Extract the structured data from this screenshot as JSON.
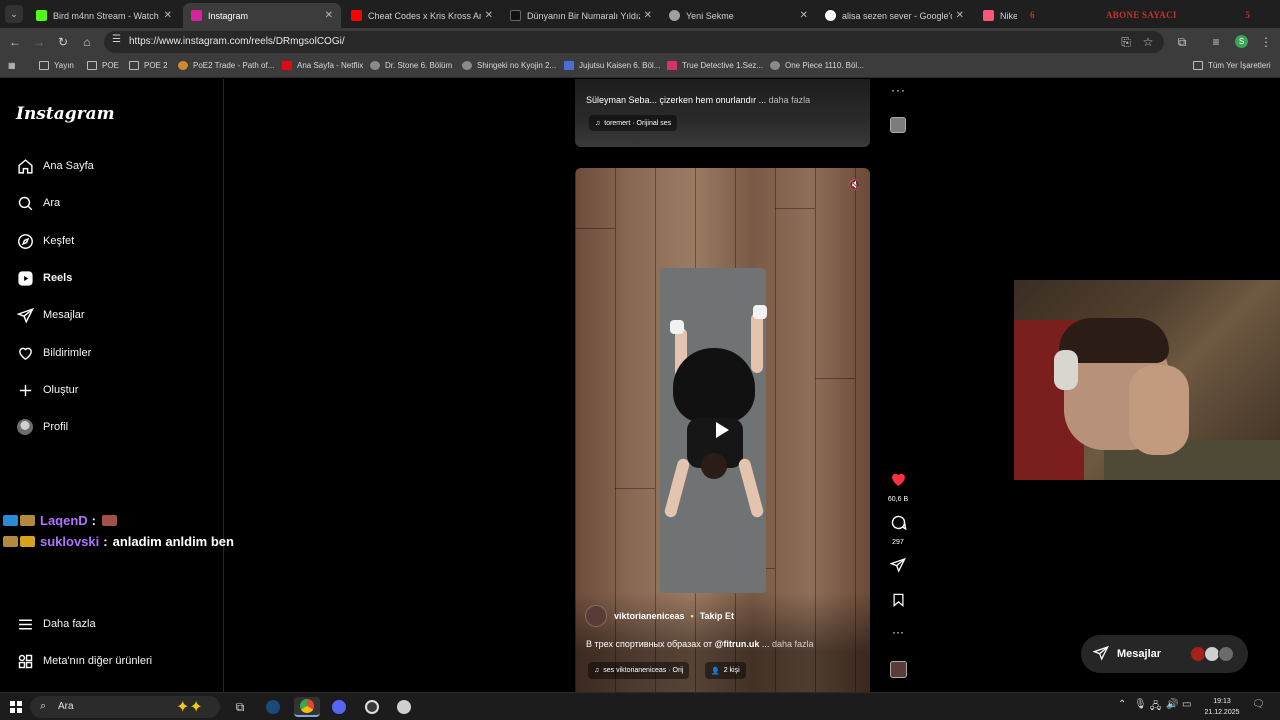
{
  "browser": {
    "tabs": [
      {
        "title": "Bird m4nn Stream - Watch Live",
        "close": "✕",
        "favicon_color": "#53fc18",
        "active": false
      },
      {
        "title": "Instagram",
        "close": "✕",
        "favicon_color": "#d6249f",
        "active": true
      },
      {
        "title": "Cheat Codes x Kris Kross Amst",
        "close": "✕",
        "favicon_color": "#ff0000",
        "active": false
      },
      {
        "title": "Dünyanın Bir Numaralı Yıldızıy",
        "close": "✕",
        "favicon_color": "#111111",
        "active": false
      },
      {
        "title": "Yeni Sekme",
        "close": "✕",
        "favicon_color": "#9aa0a6",
        "active": false
      },
      {
        "title": "alisa sezen sever - Google'da A",
        "close": "✕",
        "favicon_color": "#ffffff",
        "active": false
      },
      {
        "title": "Nike",
        "close": "",
        "favicon_color": "#ff5577",
        "active": false
      }
    ],
    "overlay": {
      "left": "6",
      "title": "ABONE SAYACI",
      "right": "5"
    },
    "url": "https://www.instagram.com/reels/DRmgsolCOGi/",
    "bookmarks": [
      {
        "label": "Yayın",
        "icon": "folder"
      },
      {
        "label": "POE",
        "icon": "folder"
      },
      {
        "label": "POE 2",
        "icon": "folder"
      },
      {
        "label": "PoE2 Trade - Path of...",
        "icon": "poe"
      },
      {
        "label": "Ana Sayfa - Netflix",
        "icon": "netflix"
      },
      {
        "label": "Dr. Stone 6. Bölüm",
        "icon": "anime"
      },
      {
        "label": "Shingeki no Kyojin 2...",
        "icon": "anime"
      },
      {
        "label": "Jujutsu Kaisen 6. Böl...",
        "icon": "anime"
      },
      {
        "label": "True Detective 1.Sez...",
        "icon": "tv"
      },
      {
        "label": "One Piece 1110. Böl...",
        "icon": "anime"
      }
    ],
    "all_bookmarks": "Tüm Yer İşaretleri"
  },
  "sidebar": {
    "logo": "Instagram",
    "items": [
      {
        "label": "Ana Sayfa",
        "icon": "home-icon",
        "active": false
      },
      {
        "label": "Ara",
        "icon": "search-icon",
        "active": false
      },
      {
        "label": "Keşfet",
        "icon": "compass-icon",
        "active": false
      },
      {
        "label": "Reels",
        "icon": "reels-icon",
        "active": true
      },
      {
        "label": "Mesajlar",
        "icon": "send-icon",
        "active": false
      },
      {
        "label": "Bildirimler",
        "icon": "heart-icon",
        "active": false
      },
      {
        "label": "Oluştur",
        "icon": "plus-icon",
        "active": false
      },
      {
        "label": "Profil",
        "icon": "avatar-icon",
        "active": false
      }
    ],
    "more": "Daha fazla",
    "meta": "Meta'nın diğer ürünleri"
  },
  "chat": [
    {
      "user": "LaqenD",
      "sep": ":",
      "message": ""
    },
    {
      "user": "suklovski",
      "sep": ":",
      "message": "anladim anldim ben"
    }
  ],
  "feed": {
    "prev_reel": {
      "caption": "Süleyman Seba... çizerken hem onurlandır ...",
      "more": "daha fazla",
      "audio": "toremert · Orijinal ses"
    },
    "reel": {
      "author": "viktorianeniceas",
      "dot": "•",
      "follow": "Takip Et",
      "caption_text": "В трех спортивных образах от ",
      "caption_tag": "@fitrun.uk",
      "caption_ellipsis": " ... ",
      "more": "daha fazla",
      "audio": "ses  viktorianeniceas · Orij",
      "people": "2 kişi",
      "likes": "60,6 B",
      "comments": "297",
      "liked": true,
      "muted": true
    }
  },
  "messages_pill": {
    "label": "Mesajlar"
  },
  "taskbar": {
    "search": "Ara",
    "time": "19:13",
    "date": "21.12.2025"
  }
}
